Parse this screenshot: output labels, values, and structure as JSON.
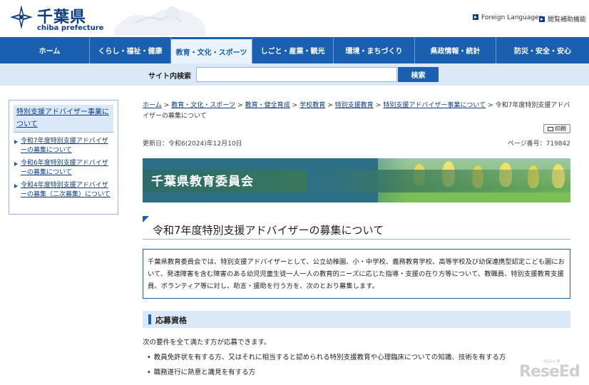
{
  "header": {
    "logo_name": "千葉県",
    "logo_sub": "chiba prefecture",
    "foreign_languages": "Foreign Languages",
    "reading_assist": "閲覧補助機能"
  },
  "gnav": [
    {
      "label": "ホーム"
    },
    {
      "label": "くらし・福祉・健康"
    },
    {
      "label": "教育・文化・スポーツ"
    },
    {
      "label": "しごと・産業・観光"
    },
    {
      "label": "環境・まちづくり"
    },
    {
      "label": "県政情報・統計"
    },
    {
      "label": "防災・安全・安心"
    }
  ],
  "search": {
    "label": "サイト内検索",
    "placeholder": "",
    "button": "検索"
  },
  "sidenav": {
    "heading": "特別支援アドバイザー事業について",
    "items": [
      "令和7年度特別支援アドバイザーの募集について",
      "令和6年度特別支援アドバイザーの募集について",
      "令和4年度特別支援アドバイザーの募集（二次募集）について"
    ]
  },
  "breadcrumb": {
    "links": [
      "ホーム",
      "教育・文化・スポーツ",
      "教育・健全育成",
      "学校教育",
      "特別支援教育",
      "特別支援アドバイザー事業について"
    ],
    "current": "令和7年度特別支援アドバイザーの募集について",
    "sep": ">"
  },
  "print_label": "印刷",
  "updated": "更新日：令和6(2024)年12月10日",
  "page_number": "ページ番号：719842",
  "banner_title": "千葉県教育委員会",
  "page_title": "令和7年度特別支援アドバイザーの募集について",
  "intro_text": "千葉県教育委員会では、特別支援アドバイザーとして、公立幼稚園、小・中学校、義務教育学校、高等学校及び幼保連携型認定こども園において、発達障害を含む障害のある幼児児童生徒一人一人の教育的ニーズに応じた指導・支援の在り方等について、教職員、特別支援教育支援員、ボランティア等に対し、助言・援助を行う方を、次のとおり募集します。",
  "section": {
    "heading": "応募資格",
    "lead": "次の要件を全て満たす方が応募できます。",
    "requirements": [
      "教員免許状を有する方、又はそれに相当すると認められる特別支援教育や心理臨床についての知識、技術を有する方",
      "職務遂行に熱意と識見を有する方"
    ]
  },
  "watermark": {
    "small": "リシード",
    "main": "ReseEd"
  },
  "colors": {
    "brand_blue": "#1a5fb0",
    "nav_light": "#dbe8f7",
    "logo_navy": "#0b3c82"
  }
}
